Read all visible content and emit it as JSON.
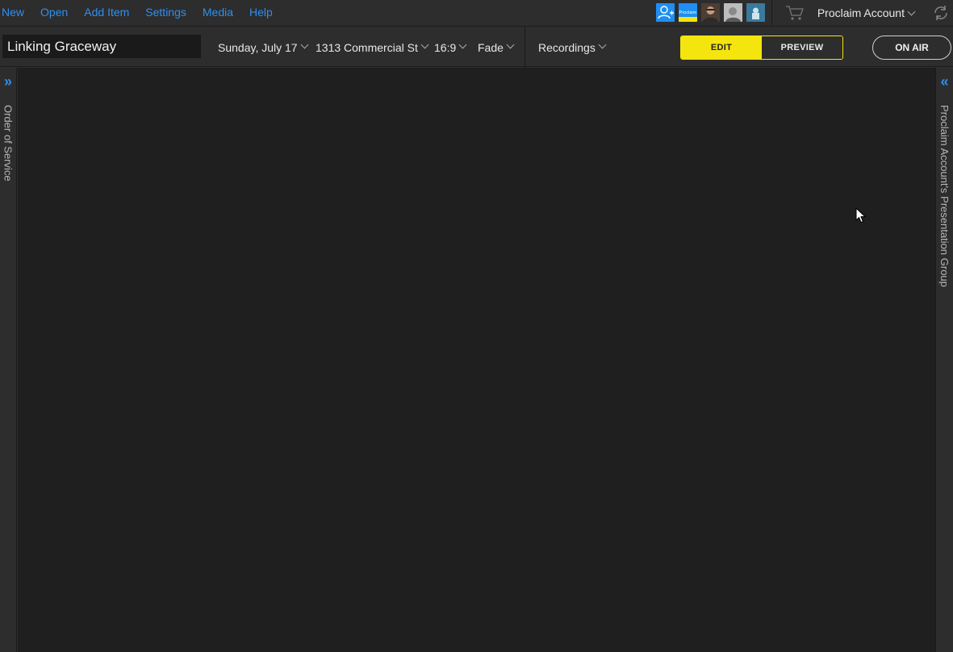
{
  "menu": {
    "items": [
      {
        "label": "New"
      },
      {
        "label": "Open"
      },
      {
        "label": "Add Item"
      },
      {
        "label": "Settings"
      },
      {
        "label": "Media"
      },
      {
        "label": "Help"
      }
    ]
  },
  "account": {
    "name": "Proclaim Account",
    "avatars": [
      "add-user-icon",
      "proclaim-logo-icon",
      "user-avatar-1",
      "user-avatar-2",
      "user-avatar-3"
    ],
    "proclaim_logo_text": "Proclaim"
  },
  "toolbar": {
    "presentation_title": "Linking Graceway",
    "date": "Sunday, July 17",
    "location": "1313 Commercial St",
    "aspect_ratio": "16:9",
    "transition": "Fade",
    "recordings": "Recordings",
    "edit_label": "EDIT",
    "preview_label": "PREVIEW",
    "on_air_label": "ON AIR"
  },
  "left_panel": {
    "toggle_icon": "»",
    "label": "Order of Service"
  },
  "right_panel": {
    "toggle_icon": "«",
    "label": "Proclaim Account's Presentation Group"
  },
  "colors": {
    "accent": "#2e8ff0",
    "edit_active": "#f5e50e",
    "background": "#2d2d2d",
    "stage": "#1f1f1f"
  }
}
